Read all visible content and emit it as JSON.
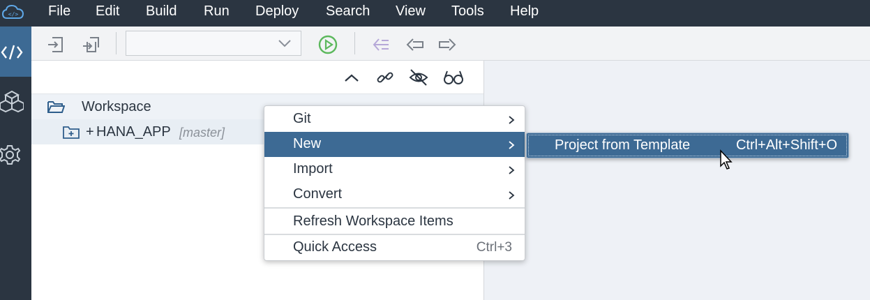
{
  "menubar": {
    "logo_icon": "cloud-code-icon",
    "items": [
      "File",
      "Edit",
      "Build",
      "Run",
      "Deploy",
      "Search",
      "View",
      "Tools",
      "Help"
    ]
  },
  "leftbar": {
    "icons": [
      "code-icon",
      "packages-icon",
      "settings-gear-icon"
    ]
  },
  "toolbar": {
    "icons": [
      "import-icon",
      "export-icon",
      "run-icon",
      "back-list-icon",
      "back-icon",
      "forward-icon"
    ],
    "run_config_value": ""
  },
  "panel_tools": {
    "icons": [
      "collapse-icon",
      "link-icon",
      "hide-icon",
      "glasses-icon"
    ]
  },
  "tree": {
    "workspace_label": "Workspace",
    "project_prefix": "+",
    "project_label": "HANA_APP",
    "project_branch": "[master]"
  },
  "context_menu": {
    "items": [
      {
        "label": "Git",
        "submenu": true
      },
      {
        "label": "New",
        "submenu": true
      },
      {
        "label": "Import",
        "submenu": true
      },
      {
        "label": "Convert",
        "submenu": true
      },
      {
        "label": "Refresh Workspace Items",
        "submenu": false
      },
      {
        "label": "Quick Access",
        "shortcut": "Ctrl+3"
      }
    ]
  },
  "submenu": {
    "label": "Project from Template",
    "shortcut": "Ctrl+Alt+Shift+O"
  },
  "colors": {
    "menubar_bg": "#2b3541",
    "accent": "#3d6a94",
    "run_green": "#5cb85c"
  }
}
